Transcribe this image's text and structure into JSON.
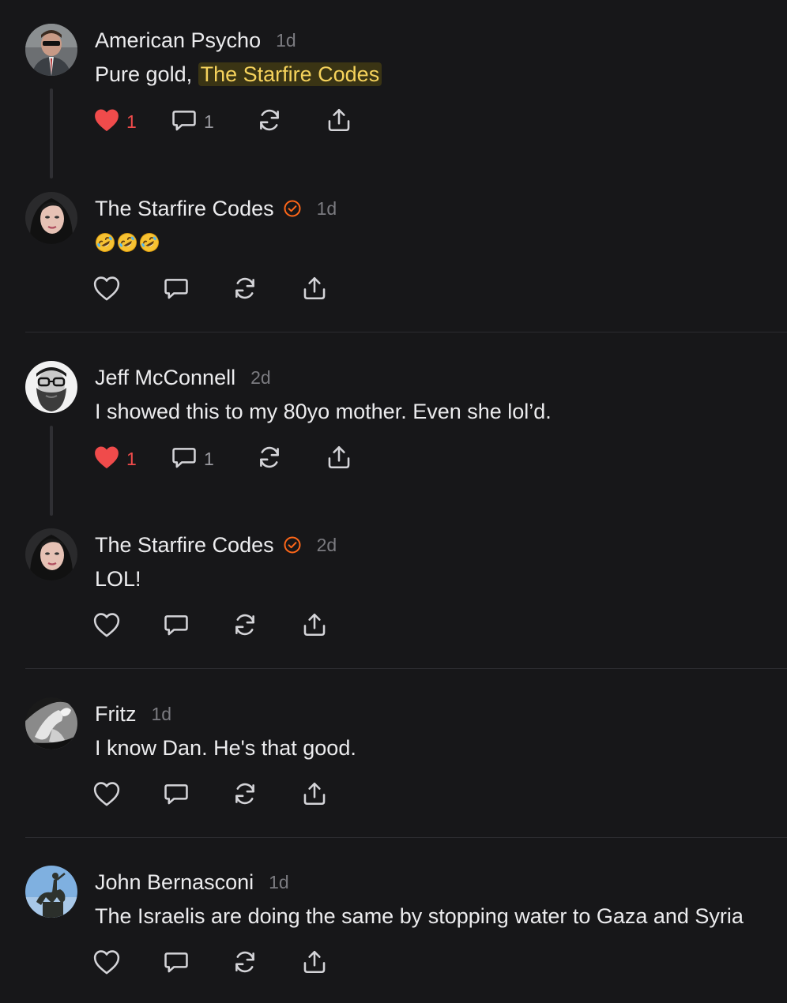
{
  "comments": [
    {
      "author": "American Psycho",
      "time": "1d",
      "verified": false,
      "text_prefix": "Pure gold, ",
      "mention": "The Starfire Codes",
      "liked": true,
      "likes": "1",
      "replies": "1",
      "avatar_icon": "avatar-photo-man-suit"
    },
    {
      "author": "The Starfire Codes",
      "time": "1d",
      "verified": true,
      "emoji_count": 3,
      "emoji_icon": "rolling-on-floor-laughing-emoji",
      "liked": false,
      "avatar_icon": "avatar-photo-woman"
    },
    {
      "author": "Jeff McConnell",
      "time": "2d",
      "verified": false,
      "text": "I showed this to my 80yo mother. Even she lol’d.",
      "liked": true,
      "likes": "1",
      "replies": "1",
      "avatar_icon": "avatar-photo-bearded-man-glasses"
    },
    {
      "author": "The Starfire Codes",
      "time": "2d",
      "verified": true,
      "text": "LOL!",
      "liked": false,
      "avatar_icon": "avatar-photo-woman"
    },
    {
      "author": "Fritz",
      "time": "1d",
      "verified": false,
      "text": "I know Dan. He's that good.",
      "liked": false,
      "avatar_icon": "avatar-photo-bw-sculpture"
    },
    {
      "author": "John Bernasconi",
      "time": "1d",
      "verified": false,
      "text": "The Israelis are doing the same by stopping water to Gaza and Syria",
      "liked": false,
      "avatar_icon": "avatar-photo-equestrian-statue"
    }
  ],
  "colors": {
    "background": "#171719",
    "text": "#ececee",
    "muted": "#7b7b80",
    "like_red": "#f04b4b",
    "verified_orange": "#ff6719",
    "mention_text": "#f5d25c",
    "mention_bg": "#3a3414"
  },
  "icons": {
    "like": "heart-icon",
    "reply": "speech-bubble-icon",
    "restack": "restack-arrows-icon",
    "share": "share-upload-icon",
    "verified": "verified-check-badge-icon"
  }
}
